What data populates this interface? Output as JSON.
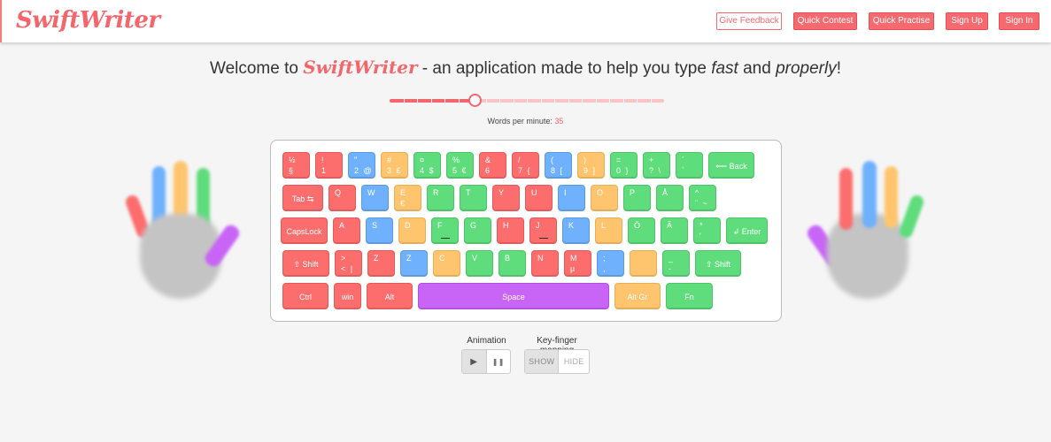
{
  "app": {
    "logo": "SwiftWriter"
  },
  "nav": {
    "feedback": "Give Feedback",
    "contest": "Quick Contest",
    "practise": "Quick Practise",
    "signup": "Sign Up",
    "signin": "Sign In"
  },
  "welcome": {
    "pre": "Welcome to ",
    "brand": "SwiftWriter",
    "mid": " - an application made to help you type ",
    "fast": "fast",
    "and": " and ",
    "properly": "properly",
    "end": "!"
  },
  "speed": {
    "label": "Words per minute: ",
    "value": "35",
    "slider_fraction": 0.31
  },
  "keyboard": {
    "rows": [
      [
        {
          "top": "½",
          "bot": "§",
          "color": "red"
        },
        {
          "top": "!",
          "bot": "1",
          "color": "red"
        },
        {
          "top": "\"",
          "bot": "2 @",
          "color": "blue"
        },
        {
          "top": "#",
          "bot": "3 £",
          "color": "yellow"
        },
        {
          "top": "¤",
          "bot": "4 $",
          "color": "green"
        },
        {
          "top": "%",
          "bot": "5 €",
          "color": "green"
        },
        {
          "top": "&",
          "bot": "6",
          "color": "red"
        },
        {
          "top": "/",
          "bot": "7 {",
          "color": "red"
        },
        {
          "top": "(",
          "bot": "8 [",
          "color": "blue"
        },
        {
          "top": ")",
          "bot": "9 ]",
          "color": "yellow"
        },
        {
          "top": "=",
          "bot": "0 }",
          "color": "green"
        },
        {
          "top": "+",
          "bot": "? \\",
          "color": "green"
        },
        {
          "top": "´",
          "bot": "`",
          "color": "green"
        },
        {
          "label": "⟵ Back",
          "color": "green"
        }
      ],
      [
        {
          "label": "Tab ⇆",
          "color": "red"
        },
        {
          "top": "Q",
          "bot": "",
          "color": "red"
        },
        {
          "top": "W",
          "bot": "",
          "color": "blue"
        },
        {
          "top": "E",
          "bot": "€",
          "color": "yellow"
        },
        {
          "top": "R",
          "bot": "",
          "color": "green"
        },
        {
          "top": "T",
          "bot": "",
          "color": "green"
        },
        {
          "top": "Y",
          "bot": "",
          "color": "red"
        },
        {
          "top": "U",
          "bot": "",
          "color": "red"
        },
        {
          "top": "I",
          "bot": "",
          "color": "blue"
        },
        {
          "top": "O",
          "bot": "",
          "color": "yellow"
        },
        {
          "top": "P",
          "bot": "",
          "color": "green"
        },
        {
          "top": "Å",
          "bot": "",
          "color": "green"
        },
        {
          "top": "^",
          "bot": "¨ ~",
          "color": "green"
        }
      ],
      [
        {
          "label": "CapsLock",
          "color": "red"
        },
        {
          "top": "A",
          "bot": "",
          "color": "red"
        },
        {
          "top": "S",
          "bot": "",
          "color": "blue"
        },
        {
          "top": "D",
          "bot": "",
          "color": "yellow"
        },
        {
          "top": "F",
          "bot": "",
          "color": "green",
          "bump": true
        },
        {
          "top": "G",
          "bot": "",
          "color": "green"
        },
        {
          "top": "H",
          "bot": "",
          "color": "red"
        },
        {
          "top": "J",
          "bot": "",
          "color": "red",
          "bump": true
        },
        {
          "top": "K",
          "bot": "",
          "color": "blue"
        },
        {
          "top": "L",
          "bot": "",
          "color": "yellow"
        },
        {
          "top": "Ö",
          "bot": "",
          "color": "green"
        },
        {
          "top": "Ä",
          "bot": "",
          "color": "green"
        },
        {
          "top": "*",
          "bot": "'",
          "color": "green"
        },
        {
          "label": "↲ Enter",
          "color": "green"
        }
      ],
      [
        {
          "label": "⇧ Shift",
          "color": "red"
        },
        {
          "top": ">",
          "bot": "< |",
          "color": "red"
        },
        {
          "top": "Z",
          "bot": "",
          "color": "red"
        },
        {
          "top": "Z",
          "bot": "",
          "color": "blue"
        },
        {
          "top": "C",
          "bot": "",
          "color": "yellow"
        },
        {
          "top": "V",
          "bot": "",
          "color": "green"
        },
        {
          "top": "B",
          "bot": "",
          "color": "green"
        },
        {
          "top": "N",
          "bot": "",
          "color": "red"
        },
        {
          "top": "M",
          "bot": "µ",
          "color": "red"
        },
        {
          "top": ";",
          "bot": ",",
          "color": "blue"
        },
        {
          "top": "",
          "bot": "",
          "color": "yellow"
        },
        {
          "top": "_",
          "bot": "-",
          "color": "green"
        },
        {
          "label": "⇧ Shift",
          "color": "green"
        }
      ],
      [
        {
          "label": "Ctrl",
          "color": "red"
        },
        {
          "label": "win",
          "color": "red"
        },
        {
          "label": "Alt",
          "color": "red"
        },
        {
          "label": "Space",
          "color": "purple"
        },
        {
          "label": "Alt Gr",
          "color": "yellow"
        },
        {
          "label": "Fn",
          "color": "green"
        }
      ]
    ]
  },
  "controls": {
    "animation_label": "Animation",
    "mapping_label": "Key-finger mapping",
    "play_icon": "▶",
    "pause_icon": "❚❚",
    "show": "SHOW",
    "hide": "HIDE"
  },
  "colors": {
    "accent": "#f4666c",
    "red": "#fc6d6d",
    "blue": "#6fb1fc",
    "yellow": "#fec56e",
    "green": "#5fdc7c",
    "purple": "#c865f6"
  }
}
